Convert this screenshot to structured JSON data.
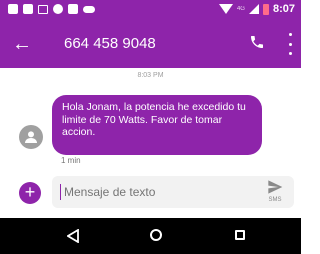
{
  "colors": {
    "accent": "#8e24aa",
    "bubble_text": "#ffffff",
    "navbar": "#000000"
  },
  "statusbar": {
    "time": "8:07",
    "network_label": "4G",
    "icons": [
      "notification-icon",
      "message-icon",
      "chat-icon",
      "whatsapp-icon",
      "tools-icon",
      "voicemail-icon",
      "wifi-icon",
      "signal-icon",
      "battery-icon"
    ]
  },
  "appbar": {
    "title": "664 458 9048",
    "back_icon": "arrow-back-icon",
    "call_icon": "phone-icon",
    "menu_icon": "more-vert-icon"
  },
  "conversation": {
    "timestamp": "8:03 PM",
    "message": {
      "text": "Hola Jonam, la potencia he excedido tu limite de 70 Watts. Favor de tomar accion.",
      "time": "1 min",
      "avatar_icon": "person-icon"
    }
  },
  "composer": {
    "placeholder": "Mensaje de texto",
    "add_icon": "add-icon",
    "send_label": "SMS",
    "send_icon": "send-icon"
  },
  "navbar": {
    "icons": [
      "nav-back-icon",
      "nav-home-icon",
      "nav-recents-icon"
    ]
  }
}
